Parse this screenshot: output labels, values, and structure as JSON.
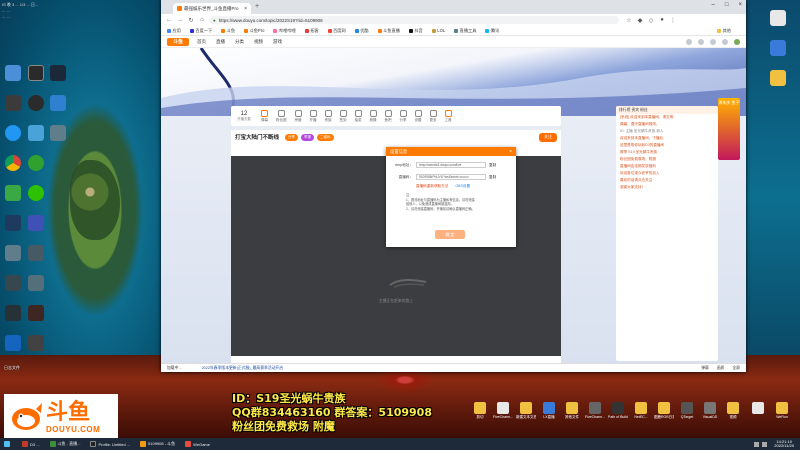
{
  "desktop": {
    "top_left_lines": [
      "IS 晚 3 ... 1/3 ... 日...",
      "... ...",
      "... ..."
    ],
    "icons_left": [
      {
        "label": "日志文件",
        "color": "#4a8fd8"
      },
      {
        "label": "",
        "color": "#2a7f2a"
      },
      {
        "label": "",
        "color": "#d35400"
      },
      {
        "label": "",
        "color": "#1a6fd0"
      },
      {
        "label": "",
        "color": "#30a030"
      }
    ],
    "files_right": [
      {
        "label": "剪切",
        "color": "#f0c040"
      },
      {
        "label": "FiveCharm...",
        "color": "#e8e8e8"
      },
      {
        "label": "新建文本文档",
        "color": "#f0c040"
      },
      {
        "label": "LX直播",
        "color": "#3a7ad8"
      },
      {
        "label": "其他文件",
        "color": "#f0c040"
      },
      {
        "label": "FiveCharm...",
        "color": "#666"
      },
      {
        "label": "Path of Building",
        "color": "#333"
      },
      {
        "label": "NetEC...",
        "color": "#f0c040"
      },
      {
        "label": "图鹿RGB日志",
        "color": "#f0c040"
      },
      {
        "label": "QTarget",
        "color": "#555"
      },
      {
        "label": "VisualDD",
        "color": "#777"
      },
      {
        "label": "视频",
        "color": "#f0c040"
      },
      {
        "label": "",
        "color": "#e8e8e8"
      },
      {
        "label": "WeRun",
        "color": "#f0c040"
      }
    ]
  },
  "browser": {
    "tab_title": "最强娱乐世界_斗鱼直播Pro",
    "address": "https://www.douyu.com/topic/2022S19?rid=5109908",
    "bookmarks": [
      "应用",
      "百度一下",
      "斗鱼",
      "斗鱼Pro",
      "哔哩哔哩",
      "拓客",
      "百度网",
      "优酷",
      "斗鱼直播",
      "抖音",
      "LOL",
      "直播工具",
      "腾讯",
      "其他"
    ],
    "site": {
      "logo": "斗鱼",
      "nav": [
        "首页",
        "直播",
        "分类",
        "视频",
        "游戏"
      ],
      "banner_badge": "周年庆 鱼子",
      "fans_count": "12",
      "fans_label": "开播天数",
      "room_tools": [
        "弹幕",
        "粉丝团",
        "房管",
        "开播",
        "贵族",
        "签到",
        "抽奖",
        "竞猜",
        "鱼吧",
        "分享",
        "设置",
        "更多",
        "工具"
      ],
      "room_title": "打宝大陆门不断线",
      "pills": [
        "分享",
        "举报",
        "二维码"
      ],
      "follow": "关注",
      "video_msg": "主播正在赶来的路上",
      "chat": [
        {
          "text": "排行榜  贵宾  粉丝",
          "c": "g"
        },
        {
          "text": "[系统] 欢迎来到本直播间，请文明",
          "c": ""
        },
        {
          "text": "弹幕，遵守直播间规则。",
          "c": ""
        },
        {
          "text": "ID: 主播 圣光蜗牛贵族 新人",
          "c": "g"
        },
        {
          "text": "欢迎来到本直播间，下播后",
          "c": ""
        },
        {
          "text": "这里是带你玩转D3的直播间",
          "c": ""
        },
        {
          "text": "赛季 S19 圣光蜗牛贵族",
          "c": ""
        },
        {
          "text": "粉丝团免费救场，附魔",
          "c": ""
        },
        {
          "text": "直播间会定期发放福利",
          "c": ""
        },
        {
          "text": "欢迎各位观众老爷的加入",
          "c": ""
        },
        {
          "text": "喜欢的话请点击关注",
          "c": ""
        },
        {
          "text": "谢谢大家支持！",
          "c": ""
        }
      ],
      "modal": {
        "title": "设置信息",
        "close": "×",
        "rows": [
          {
            "label": "rtmp地址：",
            "value": "rtmp://sendtc3.douyu.com/live",
            "btn": "复制"
          },
          {
            "label": "直播码：",
            "value": "5109908rPhUVU?wsSecret=••••••••",
            "btn": "复制"
          }
        ],
        "link_red": "直播码重新获取方法",
        "link_blue": "OBS设置",
        "notes": [
          "注：",
          "1、推流地址与直播码为主播私有信息，请勿泄露",
          "给他人，以免造成直播间被盗用。",
          "2、请勿泄露直播码，开播前请确认直播码正确。"
        ],
        "ok": "确 定"
      }
    },
    "status_left": "加载中...",
    "status_mid": "2022年春季版本更新(正式服)_最高赛季活动开启",
    "status_right": [
      "弹幕",
      "画质",
      "全屏"
    ]
  },
  "overlay": {
    "douyu_cn": "斗鱼",
    "douyu_en": "DOUYU.COM",
    "promo": [
      "ID：S19圣光蜗牛贵族",
      "QQ群834463160 群答案：5109908",
      "粉丝团免费救场 附魔"
    ]
  },
  "taskbar": {
    "tasks": [
      {
        "label": "D3 ...",
        "color": "#c0392b"
      },
      {
        "label": "斗鱼 - 直播...",
        "color": "#3c8d3c"
      },
      {
        "label": "Profile: Untitled ...",
        "color": "#222"
      },
      {
        "label": "5109908 - 斗鱼",
        "color": "#f39c12"
      },
      {
        "label": "WeGame",
        "color": "#e74c3c"
      }
    ],
    "clock_time": "14:21:10",
    "clock_date": "2022/11/20"
  },
  "colors": {
    "accent": "#ff7a00",
    "promo": "#ffe94a"
  }
}
